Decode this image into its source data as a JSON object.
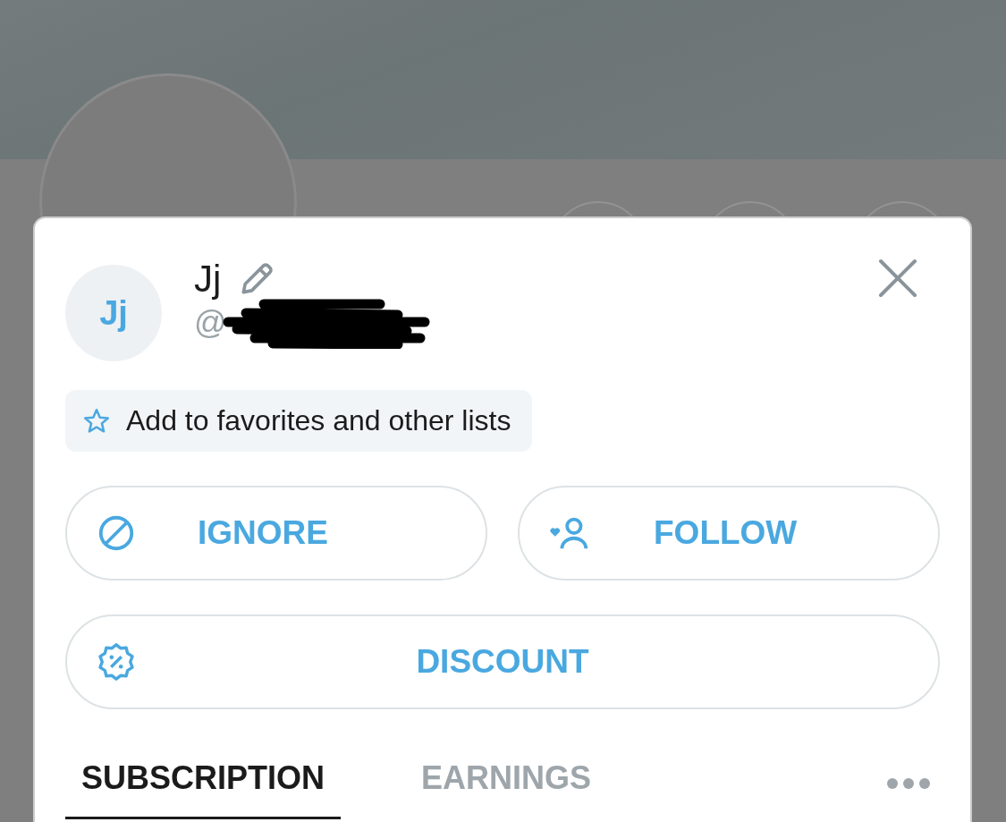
{
  "profile": {
    "name": "Jj",
    "initials": "Jj",
    "handle": "@",
    "handle_redacted": true
  },
  "favorites_button": {
    "label": "Add to favorites and other lists"
  },
  "actions": [
    {
      "kind": "ignore",
      "label": "IGNORE"
    },
    {
      "kind": "follow",
      "label": "FOLLOW"
    },
    {
      "kind": "discount",
      "label": "DISCOUNT"
    }
  ],
  "tabs": [
    {
      "label": "SUBSCRIPTION",
      "selected": true
    },
    {
      "label": "EARNINGS",
      "selected": false
    }
  ]
}
